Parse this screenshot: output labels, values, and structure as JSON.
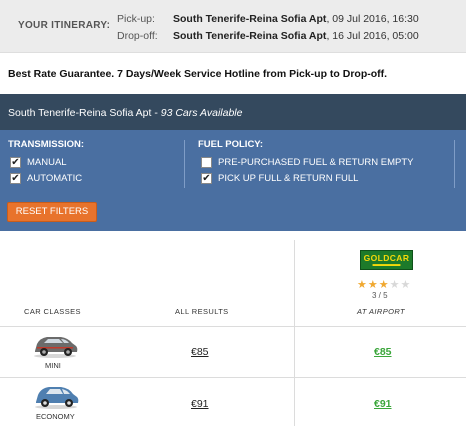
{
  "itinerary": {
    "label": "YOUR ITINERARY:",
    "pickup": {
      "key": "Pick-up:",
      "location": "South Tenerife-Reina Sofia Apt",
      "datetime": ", 09 Jul 2016, 16:30"
    },
    "dropoff": {
      "key": "Drop-off:",
      "location": "South Tenerife-Reina Sofia Apt",
      "datetime": ", 16 Jul 2016, 05:00"
    }
  },
  "guarantee": "Best Rate Guarantee. 7 Days/Week Service Hotline from Pick-up to Drop-off.",
  "location_bar": {
    "location": "South Tenerife-Reina Sofia Apt",
    "separator": " - ",
    "count": "93 Cars Available"
  },
  "filters": {
    "transmission": {
      "title": "TRANSMISSION:",
      "options": [
        {
          "label": "MANUAL",
          "checked": true
        },
        {
          "label": "AUTOMATIC",
          "checked": true
        }
      ]
    },
    "fuel_policy": {
      "title": "FUEL POLICY:",
      "options": [
        {
          "label": "PRE-PURCHASED FUEL & RETURN EMPTY",
          "checked": false
        },
        {
          "label": "PICK UP FULL & RETURN FULL",
          "checked": true
        }
      ]
    },
    "reset_label": "RESET FILTERS"
  },
  "table": {
    "headers": {
      "classes": "CAR CLASSES",
      "all": "ALL RESULTS",
      "supplier_location": "AT AIRPORT"
    },
    "supplier": {
      "logo_text": "GOLDCAR",
      "stars": 3,
      "max_stars": 5,
      "rating_text": "3 / 5"
    },
    "rows": [
      {
        "class": "MINI",
        "all_price": "€85",
        "supplier_price": "€85",
        "car_color": "#6b6b6b"
      },
      {
        "class": "ECONOMY",
        "all_price": "€91",
        "supplier_price": "€91",
        "car_color": "#4f7fb0"
      }
    ]
  },
  "colors": {
    "header_bar": "#34495e",
    "filters_bg": "#4a6fa1",
    "reset_button": "#e8732c",
    "supplier_price": "#3aa63a",
    "supplier_logo": "#1d7a2a"
  }
}
